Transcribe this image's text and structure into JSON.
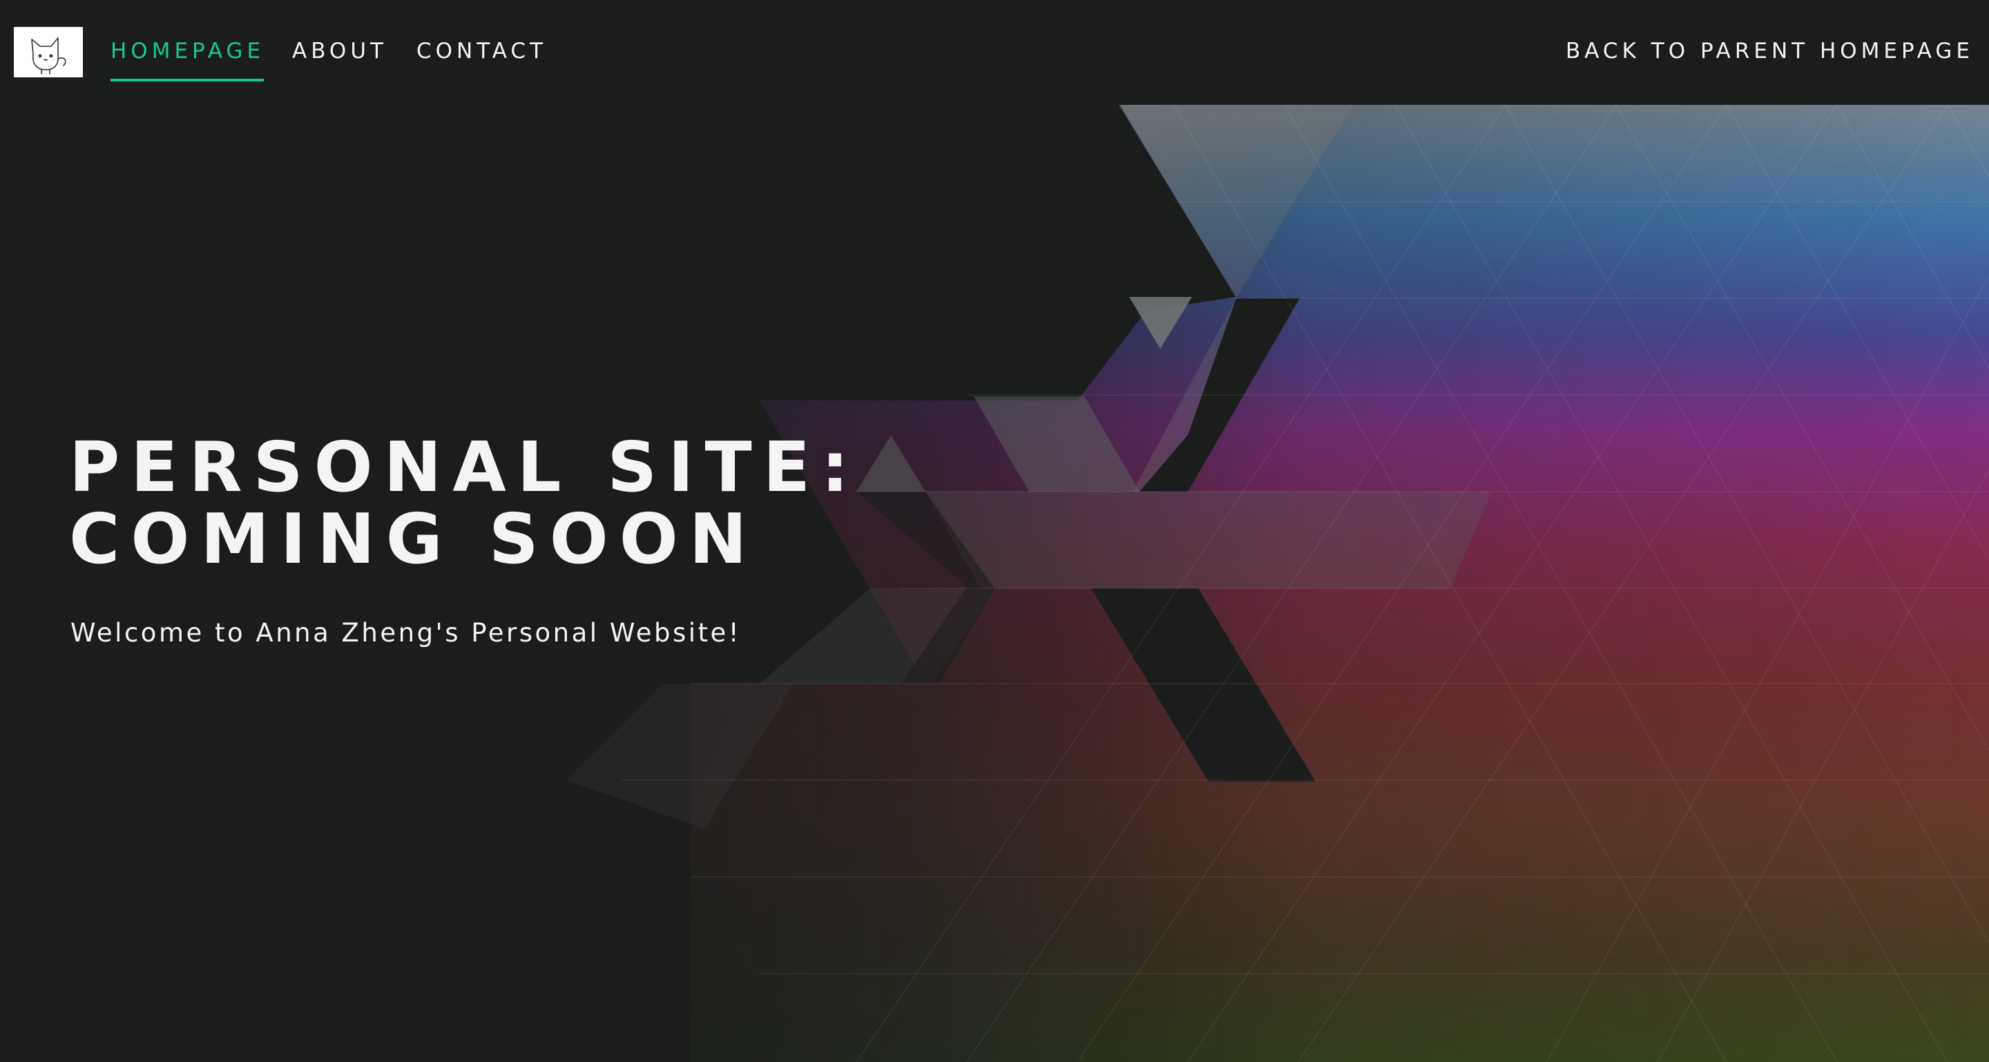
{
  "theme": {
    "accent": "#17c98f",
    "background": "#1b1d1d",
    "text": "#f3f3f3"
  },
  "nav": {
    "logo_icon": "cat-logo-icon",
    "links": [
      {
        "label": "HOMEPAGE",
        "active": true
      },
      {
        "label": "ABOUT",
        "active": false
      },
      {
        "label": "CONTACT",
        "active": false
      }
    ],
    "parent_link": "BACK TO PARENT HOMEPAGE"
  },
  "hero": {
    "title_line1": "PERSONAL SITE:",
    "title_line2": "COMING SOON",
    "subtitle": "Welcome to Anna Zheng's Personal Website!"
  }
}
